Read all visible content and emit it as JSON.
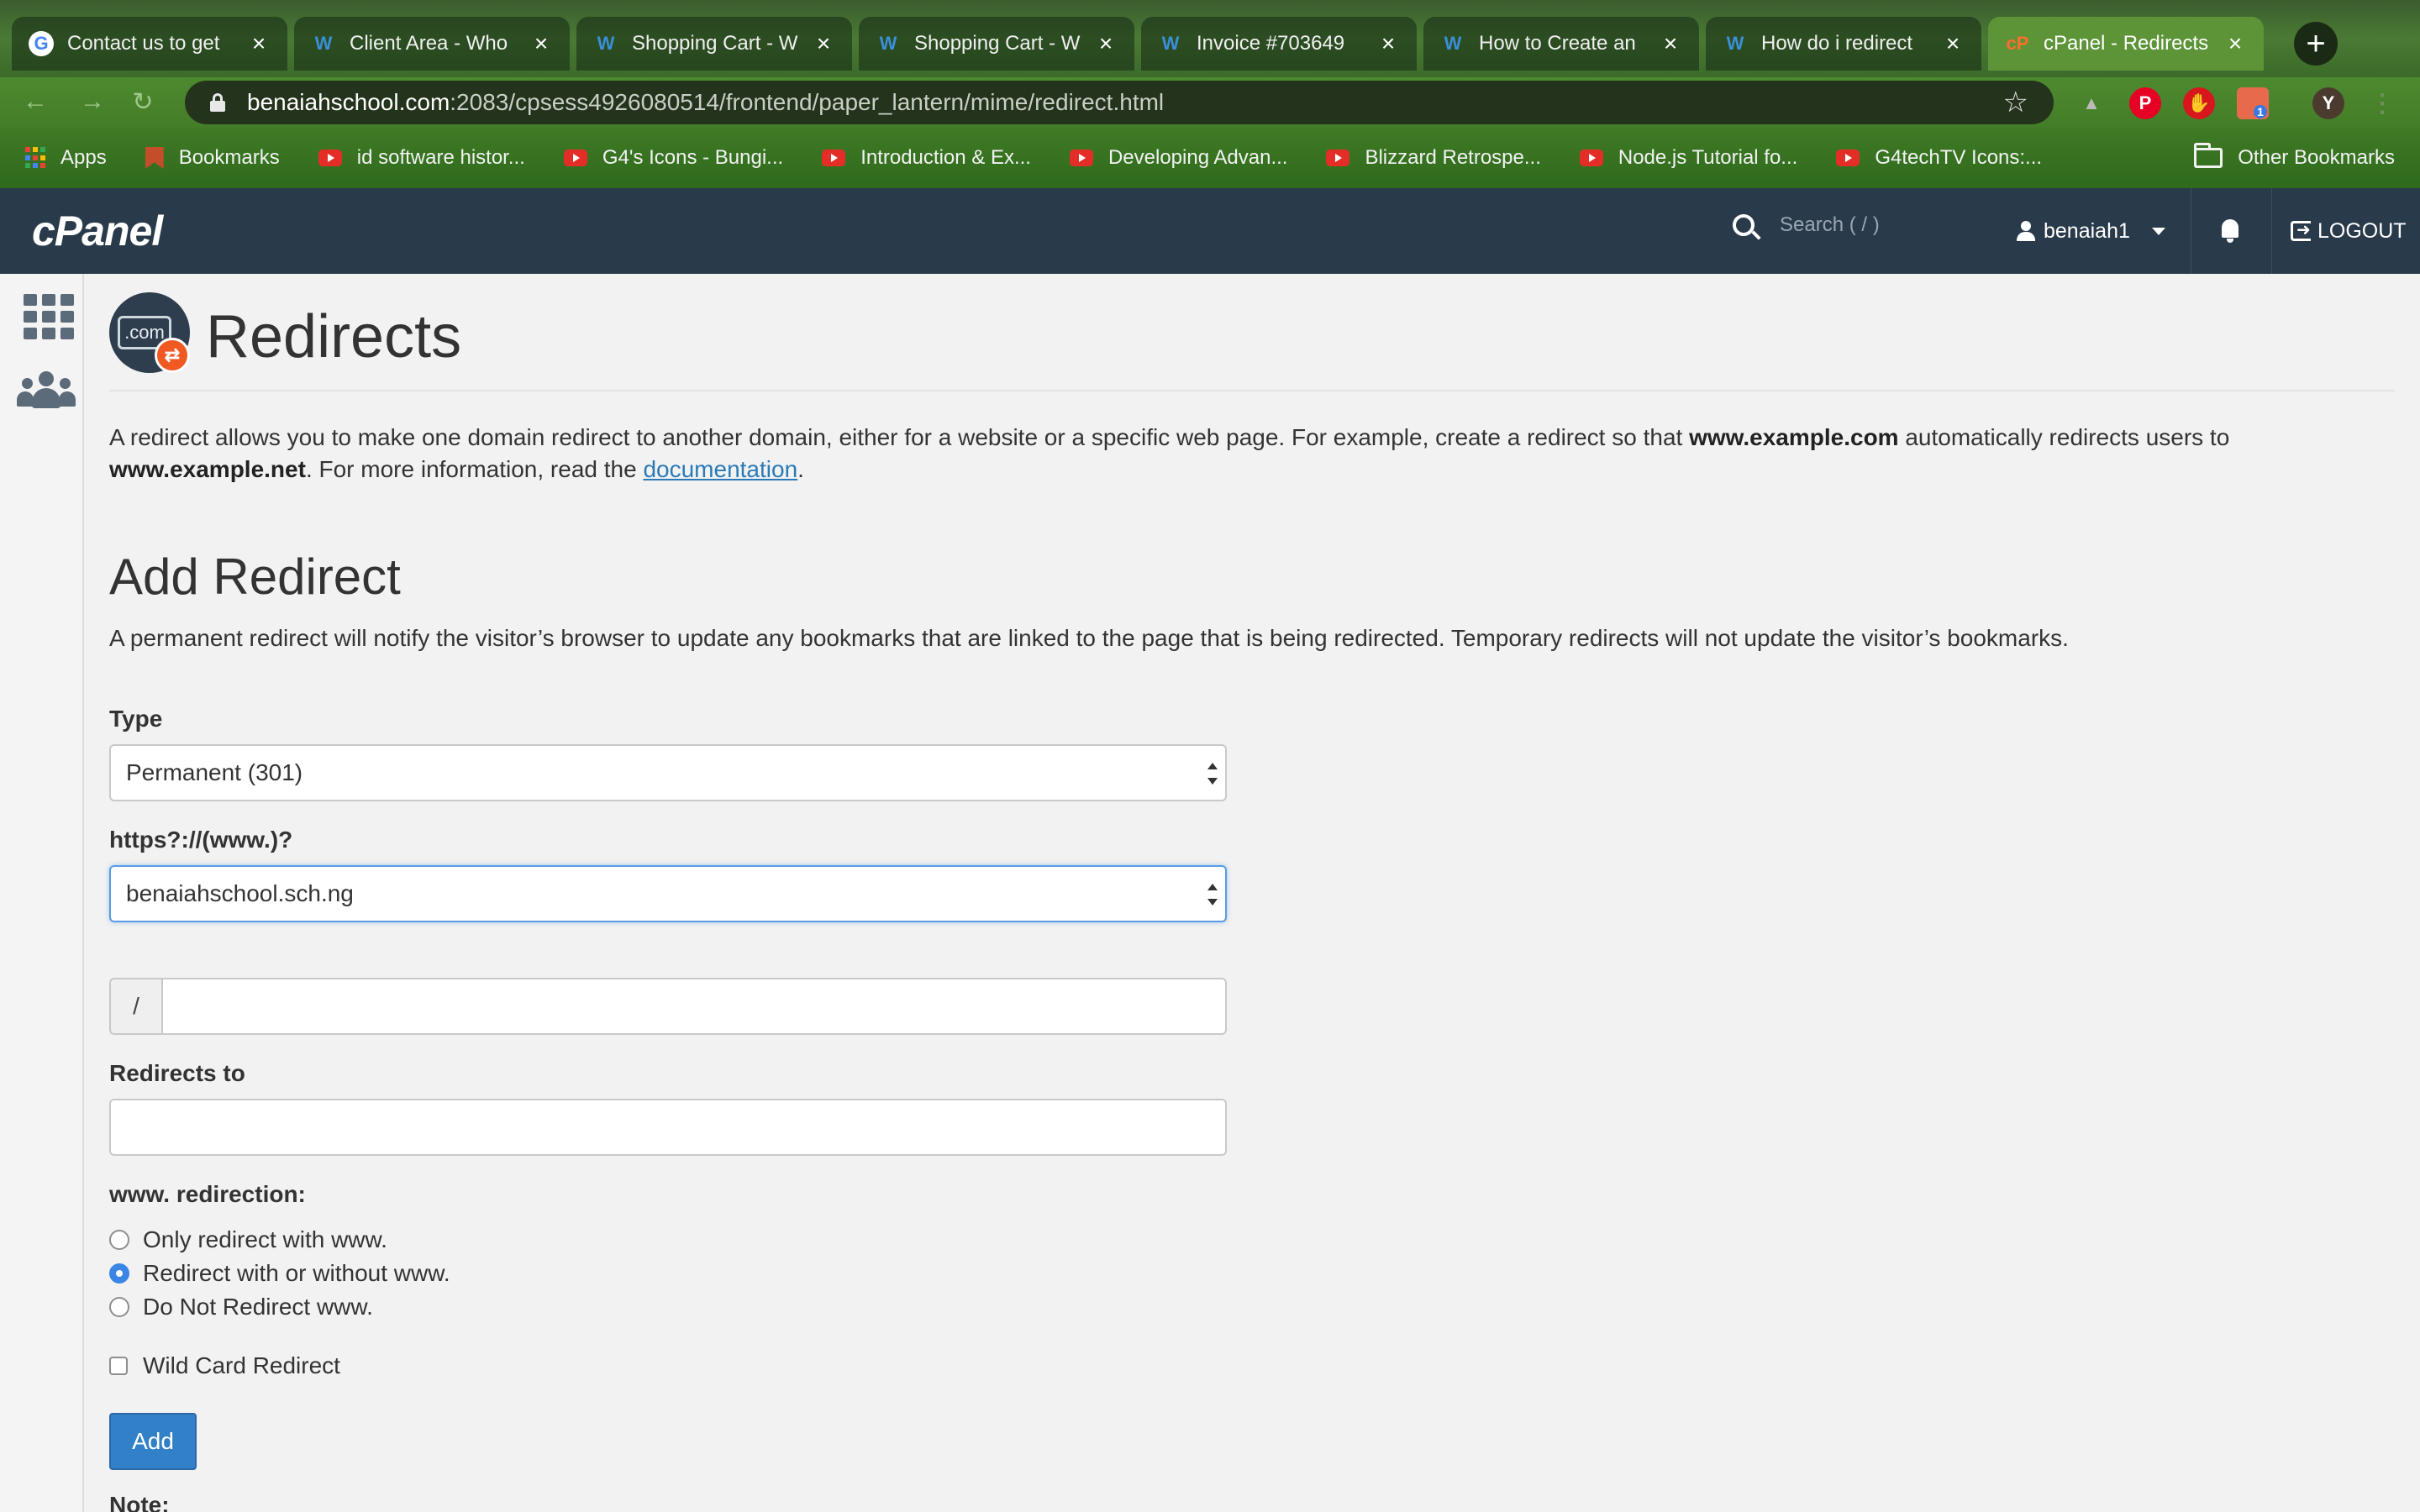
{
  "browser": {
    "tabs": [
      {
        "title": "Contact us to get",
        "icon": "google-icon"
      },
      {
        "title": "Client Area - Who",
        "icon": "whmcs-icon"
      },
      {
        "title": "Shopping Cart - W",
        "icon": "whmcs-icon"
      },
      {
        "title": "Shopping Cart - W",
        "icon": "whmcs-icon"
      },
      {
        "title": "Invoice #703649",
        "icon": "whmcs-icon"
      },
      {
        "title": "How to Create an",
        "icon": "whmcs-icon"
      },
      {
        "title": "How do i redirect",
        "icon": "whmcs-icon"
      },
      {
        "title": "cPanel - Redirects",
        "icon": "cpanel-icon",
        "active": true
      }
    ],
    "new_tab_label": "+",
    "url_host": "benaiahschool.com",
    "url_path": ":2083/cpsess4926080514/frontend/paper_lantern/mime/redirect.html",
    "profile_initial": "Y",
    "extension_badge": "1",
    "bookmarks": [
      {
        "label": "Apps",
        "icon": "apps-grid-icon"
      },
      {
        "label": "Bookmarks",
        "icon": "bookmark-icon"
      },
      {
        "label": "id software histor...",
        "icon": "youtube-icon"
      },
      {
        "label": "G4's Icons - Bungi...",
        "icon": "youtube-icon"
      },
      {
        "label": "Introduction & Ex...",
        "icon": "youtube-icon"
      },
      {
        "label": "Developing Advan...",
        "icon": "youtube-icon"
      },
      {
        "label": "Blizzard Retrospe...",
        "icon": "youtube-icon"
      },
      {
        "label": "Node.js Tutorial fo...",
        "icon": "youtube-icon"
      },
      {
        "label": "G4techTV Icons:...",
        "icon": "youtube-icon"
      }
    ],
    "other_bookmarks": "Other Bookmarks"
  },
  "header": {
    "logo": "cPanel",
    "search_placeholder": "Search ( / )",
    "username": "benaiah1",
    "logout": "LOGOUT"
  },
  "page": {
    "icon_text": ".com",
    "title": "Redirects",
    "intro_part1": "A redirect allows you to make one domain redirect to another domain, either for a website or a specific web page. For example, create a redirect so that ",
    "intro_bold1": "www.example.com",
    "intro_part2": " automatically redirects users to ",
    "intro_bold2": "www.example.net",
    "intro_part3": ". For more information, read the ",
    "intro_link": "documentation",
    "intro_end": "."
  },
  "form": {
    "section_title": "Add Redirect",
    "section_desc": "A permanent redirect will notify the visitor’s browser to update any bookmarks that are linked to the page that is being redirected. Temporary redirects will not update the visitor’s bookmarks.",
    "type_label": "Type",
    "type_value": "Permanent (301)",
    "domain_label": "https?://(www.)?",
    "domain_value": "benaiahschool.sch.ng",
    "path_prefix": "/",
    "path_value": "",
    "redirects_to_label": "Redirects to",
    "redirects_to_value": "",
    "www_label": "www. redirection:",
    "www_options": [
      {
        "label": "Only redirect with www.",
        "checked": false
      },
      {
        "label": "Redirect with or without www.",
        "checked": true
      },
      {
        "label": "Do Not Redirect www.",
        "checked": false
      }
    ],
    "wildcard_label": "Wild Card Redirect",
    "wildcard_checked": false,
    "add_button": "Add",
    "note_label": "Note:"
  }
}
